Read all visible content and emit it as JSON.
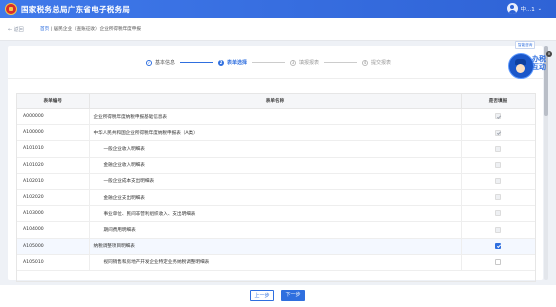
{
  "header": {
    "title": "国家税务总局广东省电子税务局",
    "user_name": "中...1",
    "user_caret": "⌄"
  },
  "breadcrumb": {
    "back_label": "← 返回",
    "items": [
      {
        "label": "首页"
      },
      {
        "label": " | "
      },
      {
        "label": "居民企业（查账征收）企业所得税年度申报"
      }
    ]
  },
  "stepper": {
    "steps": [
      {
        "number": "✓",
        "label": "基本信息",
        "state": "done"
      },
      {
        "number": "2",
        "label": "表单选择",
        "state": "active"
      },
      {
        "number": "3",
        "label": "填报报表",
        "state": "pending"
      },
      {
        "number": "4",
        "label": "提交报表",
        "state": "pending"
      }
    ]
  },
  "table": {
    "columns": [
      "表单编号",
      "表单名称",
      "是否填报"
    ],
    "rows": [
      {
        "code": "A000000",
        "name": "企业所得税年度纳税申报基础信息表",
        "indent": 0,
        "checked": true,
        "disabled": true
      },
      {
        "code": "A100000",
        "name": "中华人民共和国企业所得税年度纳税申报表（A类）",
        "indent": 0,
        "checked": true,
        "disabled": true
      },
      {
        "code": "A101010",
        "name": "一般企业收入明细表",
        "indent": 1,
        "checked": false,
        "disabled": true
      },
      {
        "code": "A101020",
        "name": "金融企业收入明细表",
        "indent": 1,
        "checked": false,
        "disabled": true
      },
      {
        "code": "A102010",
        "name": "一般企业成本支出明细表",
        "indent": 1,
        "checked": false,
        "disabled": true
      },
      {
        "code": "A102020",
        "name": "金融企业支出明细表",
        "indent": 1,
        "checked": false,
        "disabled": true
      },
      {
        "code": "A103000",
        "name": "事业单位、民间非营利组织收入、支出明细表",
        "indent": 1,
        "checked": false,
        "disabled": true
      },
      {
        "code": "A104000",
        "name": "期间费用明细表",
        "indent": 1,
        "checked": false,
        "disabled": true
      },
      {
        "code": "A105000",
        "name": "纳税调整项目明细表",
        "indent": 0,
        "checked": true,
        "disabled": false
      },
      {
        "code": "A105010",
        "name": "视同销售和房地产开发企业特定业务纳税调整明细表",
        "indent": 1,
        "checked": false,
        "disabled": false
      }
    ]
  },
  "help_widget": {
    "label": "智能咨询",
    "chars": "办税互动",
    "close": "×",
    "mascot_icon": "tax-mascot-icon"
  },
  "footer": {
    "prev_label": "上一步",
    "next_label": "下一步"
  },
  "colors": {
    "primary": "#2f6fdf",
    "topbar": "#3f79ea",
    "background": "#eef1f6"
  }
}
